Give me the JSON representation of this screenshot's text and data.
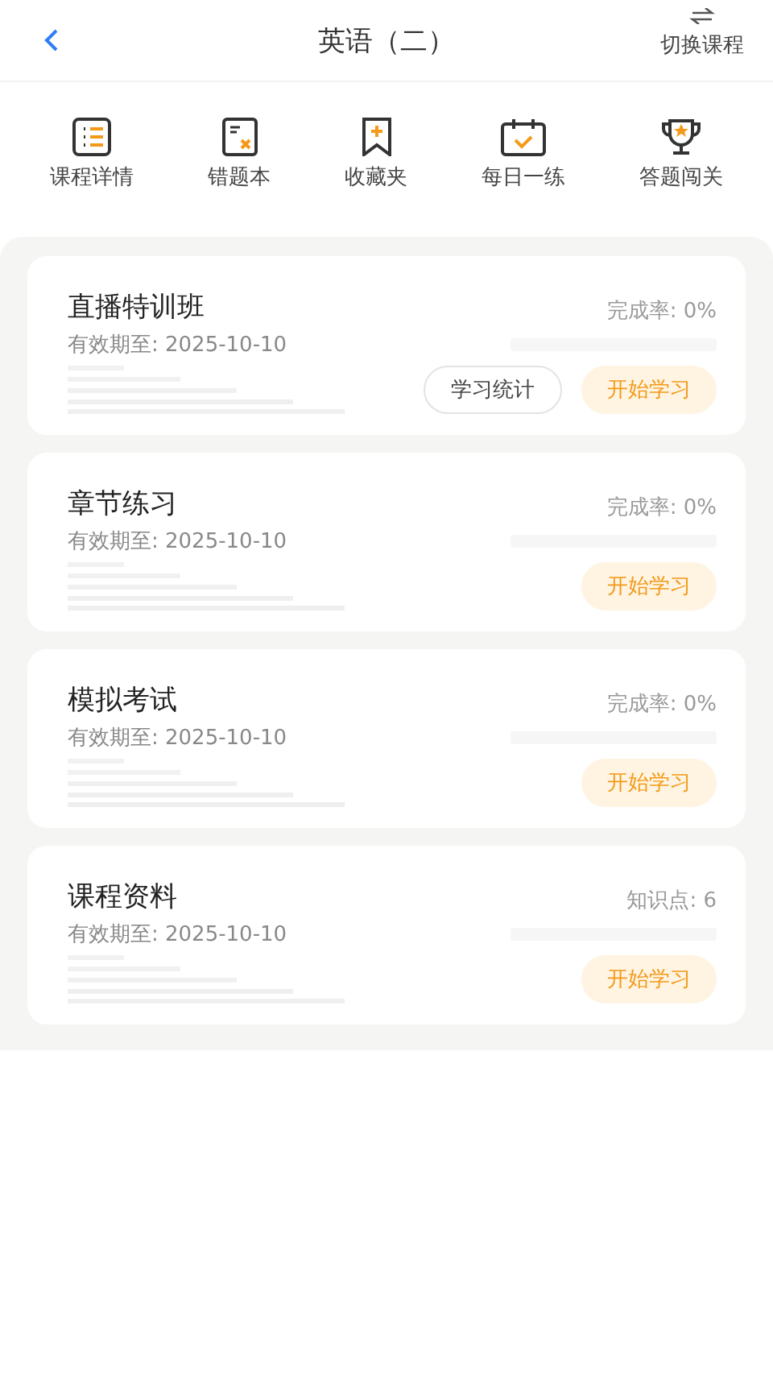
{
  "header": {
    "title": "英语（二）",
    "switch_label": "切换课程"
  },
  "shortcuts": [
    {
      "kind": "list",
      "label": "课程详情"
    },
    {
      "kind": "wrong",
      "label": "错题本"
    },
    {
      "kind": "bookmark",
      "label": "收藏夹"
    },
    {
      "kind": "calendar",
      "label": "每日一练"
    },
    {
      "kind": "trophy",
      "label": "答题闯关"
    }
  ],
  "cards": [
    {
      "title": "直播特训班",
      "validity": "有效期至: 2025-10-10",
      "stat": "完成率: 0%",
      "level": 0,
      "buttons": [
        {
          "kind": "secondary",
          "label": "学习统计"
        },
        {
          "kind": "primary",
          "label": "开始学习"
        }
      ]
    },
    {
      "title": "章节练习",
      "validity": "有效期至: 2025-10-10",
      "stat": "完成率: 0%",
      "level": 0,
      "buttons": [
        {
          "kind": "primary",
          "label": "开始学习"
        }
      ]
    },
    {
      "title": "模拟考试",
      "validity": "有效期至: 2025-10-10",
      "stat": "完成率: 0%",
      "level": 0,
      "buttons": [
        {
          "kind": "primary",
          "label": "开始学习"
        }
      ]
    },
    {
      "title": "课程资料",
      "validity": "有效期至: 2025-10-10",
      "stat": "知识点: 6",
      "level": 0,
      "buttons": [
        {
          "kind": "primary",
          "label": "开始学习"
        }
      ]
    }
  ]
}
